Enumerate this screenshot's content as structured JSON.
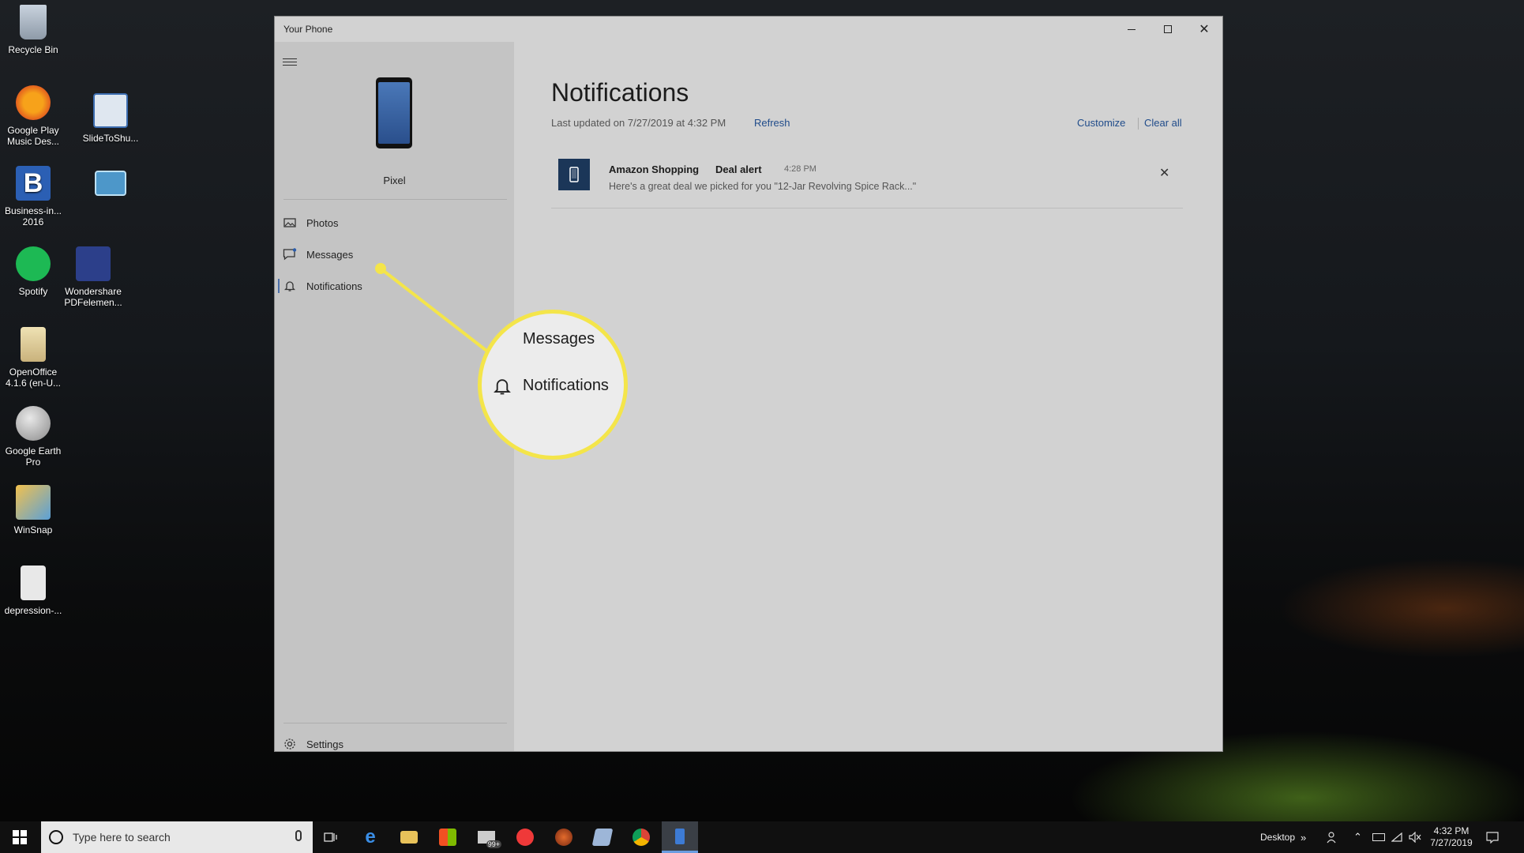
{
  "desktop": {
    "icons": [
      {
        "label": "Recycle Bin"
      },
      {
        "label": "Google Play Music Des..."
      },
      {
        "label": "SlideToShu..."
      },
      {
        "label": "Business-in... 2016"
      },
      {
        "label": "Spotify"
      },
      {
        "label": "Wondershare PDFelemen..."
      },
      {
        "label": "OpenOffice 4.1.6 (en-U..."
      },
      {
        "label": "Google Earth Pro"
      },
      {
        "label": "WinSnap"
      },
      {
        "label": "depression-..."
      }
    ]
  },
  "window": {
    "title": "Your Phone",
    "device_name": "Pixel",
    "nav": [
      {
        "label": "Photos",
        "icon": "photos-icon"
      },
      {
        "label": "Messages",
        "icon": "messages-icon"
      },
      {
        "label": "Notifications",
        "icon": "bell-icon",
        "active": true
      }
    ],
    "settings_label": "Settings",
    "main": {
      "title": "Notifications",
      "last_updated": "Last updated on 7/27/2019 at 4:32 PM",
      "refresh_label": "Refresh",
      "customize_label": "Customize",
      "clear_all_label": "Clear all",
      "notifications": [
        {
          "app": "Amazon Shopping",
          "title": "Deal alert",
          "time": "4:28 PM",
          "body": "Here's a great deal we picked for you \"12-Jar Revolving Spice Rack...\""
        }
      ]
    }
  },
  "callout": {
    "messages_label": "Messages",
    "notifications_label": "Notifications",
    "color": "#f4e54a"
  },
  "taskbar": {
    "search_placeholder": "Type here to search",
    "desktop_label": "Desktop",
    "time": "4:32 PM",
    "date": "7/27/2019",
    "mail_badge": "99+"
  }
}
